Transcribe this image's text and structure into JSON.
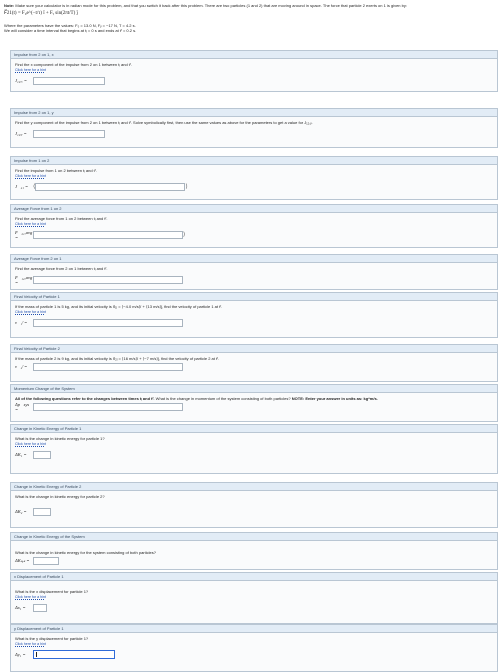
{
  "note": {
    "label": "Note:",
    "text": "Make sure your calculator is in radian mode for this problem, and that you switch it back after this problem. There are two particles (1 and 2) that are moving around in space. The force that particle 2 exerts on 1 is given by:"
  },
  "formula": "F⃗21(t) = F₀e^(−t/τ) î + Fᵧ sin(2πt/T) ĵ",
  "params": {
    "line1": "Where the parameters have the values: F₀ = 13.0 N, Fᵧ = −17 N, T = 4.2 s.",
    "line2": "We will consider a time interval that begins at tᵢ = 0 s and ends at tᶠ = 0.2 s."
  },
  "hint_label": "Click here for a hint",
  "sections": [
    {
      "id": "impulse-x",
      "header": "Impulse from 2 on 1, x",
      "question": "Find the x component of the impulse from 2 on 1 between tᵢ and tᶠ.",
      "symbol": "J₁₂,ₓ ="
    },
    {
      "id": "impulse-y",
      "header": "Impulse from 2 on 1, y",
      "question": "Find the y component of the impulse from 2 on 1 between tᵢ and tᶠ. Solve symbolically first, then use the same values as above for the parameters to get a value for J₁₂,ᵧ.",
      "symbol": "J₁₂,ᵧ ="
    },
    {
      "id": "impulse",
      "header": "Impulse from 1 on 2",
      "question": "Find the impulse from 1 on 2 between tᵢ and tᶠ.",
      "symbol": "J⃗₂₁ ="
    },
    {
      "id": "avg-force-12",
      "header": "Average Force from 1 on 2",
      "question": "Find the average force from 1 on 2 between tᵢ and tᶠ.",
      "symbol": "F⃗₂₁,avg ="
    },
    {
      "id": "avg-force-21",
      "header": "Average Force from 2 on 1",
      "question": "Find the average force from 2 on 1 between tᵢ and tᶠ.",
      "symbol": "F⃗₁₂,avg ="
    },
    {
      "id": "final-v1",
      "header": "Final Velocity of Particle 1",
      "question": "If the mass of particle 1 is 5 kg, and its initial velocity is v⃗₁ᵢ = ⟨−4.0 m/s⟩î + ⟨13 m/s⟩ĵ, find the velocity of particle 1 at tᶠ.",
      "symbol": "v⃗₁ᶠ ="
    },
    {
      "id": "final-v2",
      "header": "Final Velocity of Particle 2",
      "question": "If the mass of particle 2 is 9 kg, and its initial velocity is v⃗₂ᵢ = ⟨16 m/s⟩î + ⟨−7 m/s⟩ĵ, find the velocity of particle 2 at tᶠ.",
      "symbol": "v⃗₂ᶠ ="
    },
    {
      "id": "momentum",
      "header": "Momentum Change of the System",
      "bold_question": "All of the following questions refer to the changes between times tᵢ and tᶠ.",
      "question": "What is the change in momentum of the system consisting of both particles?",
      "bold_note": "NOTE: Enter your answer in units as: kg*m/s.",
      "symbol": "Δp⃗sys ="
    },
    {
      "id": "ke1",
      "header": "Change in Kinetic Energy of Particle 1",
      "question": "What is the change in kinetic energy for particle 1?",
      "symbol": "ΔK₁ ="
    },
    {
      "id": "ke2",
      "header": "Change in Kinetic Energy of Particle 2",
      "question": "What is the change in kinetic energy for particle 2?",
      "symbol": "ΔK₂ ="
    },
    {
      "id": "ke-sys",
      "header": "Change in Kinetic Energy of the System",
      "question": "What is the change in kinetic energy for the system consisting of both particles?",
      "symbol": "ΔKₛᵧₛ ="
    },
    {
      "id": "dx1",
      "header": "x Displacement of Particle 1",
      "question": "What is the x displacement for particle 1?",
      "symbol": "Δx₁ ="
    },
    {
      "id": "dy1",
      "header": "y Displacement of Particle 1",
      "question": "What is the y displacement for particle 1?",
      "symbol": "Δy₁ ="
    }
  ]
}
